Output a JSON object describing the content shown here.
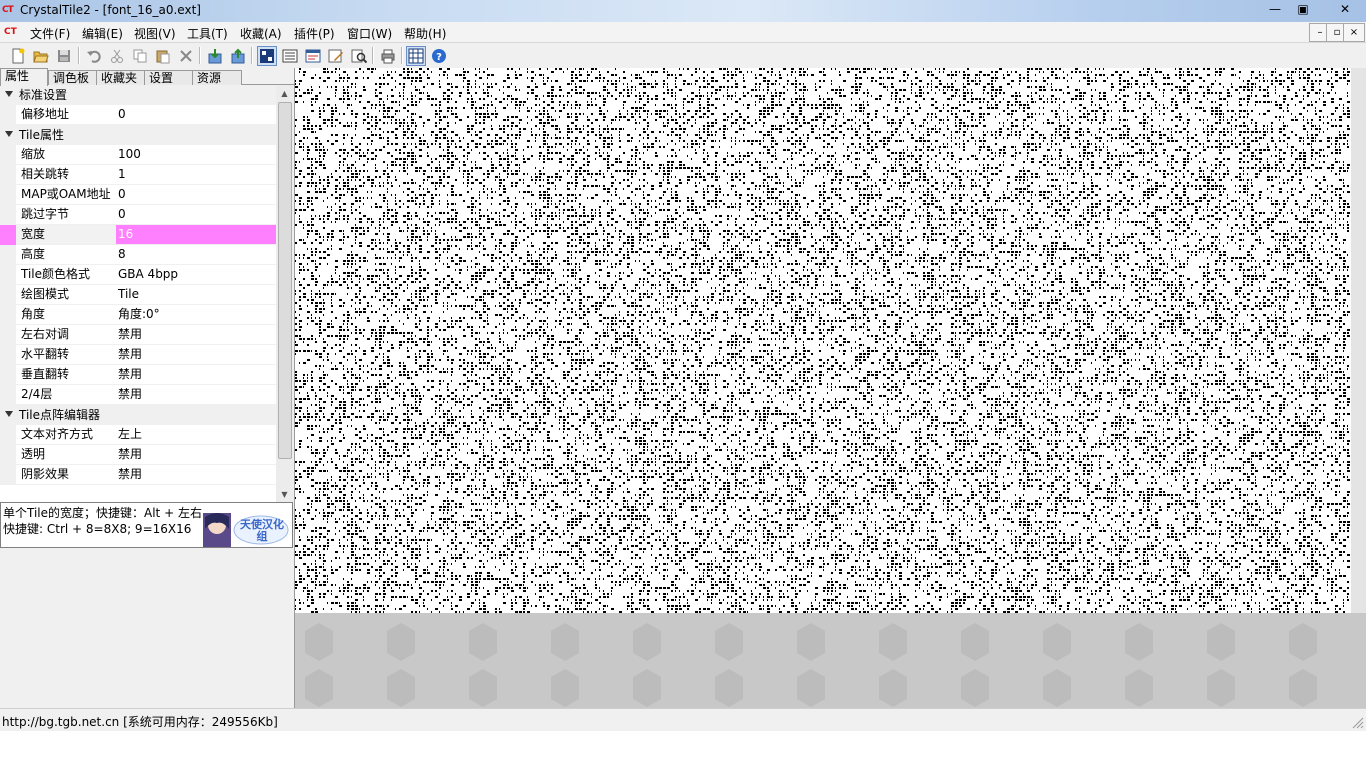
{
  "window": {
    "title": "CrystalTile2 - [font_16_a0.ext]",
    "logo_text": "CT",
    "controls": [
      "—",
      "▣",
      "✕"
    ]
  },
  "menu": {
    "items": [
      "文件(F)",
      "编辑(E)",
      "视图(V)",
      "工具(T)",
      "收藏(A)",
      "插件(P)",
      "窗口(W)",
      "帮助(H)"
    ],
    "mdi_controls": [
      "–",
      "▫",
      "×"
    ]
  },
  "toolbar": {
    "buttons": [
      "new-file",
      "open-folder",
      "save",
      "undo",
      "cut",
      "copy",
      "paste",
      "delete",
      "import",
      "export",
      "tile-view",
      "hex-view",
      "map-view",
      "edit",
      "search",
      "print",
      "grid",
      "help"
    ]
  },
  "left_panel": {
    "tabs": [
      "属性",
      "调色板",
      "收藏夹",
      "设置",
      "资源"
    ],
    "properties": [
      {
        "type": "category",
        "label": "标准设置"
      },
      {
        "type": "prop",
        "name": "偏移地址",
        "value": "0"
      },
      {
        "type": "category",
        "label": "Tile属性"
      },
      {
        "type": "prop",
        "name": "缩放",
        "value": "100"
      },
      {
        "type": "prop",
        "name": "相关跳转",
        "value": "1"
      },
      {
        "type": "prop",
        "name": "MAP或OAM地址",
        "value": "0"
      },
      {
        "type": "prop",
        "name": "跳过字节",
        "value": "0"
      },
      {
        "type": "prop",
        "name": "宽度",
        "value": "16",
        "selected": true
      },
      {
        "type": "prop",
        "name": "高度",
        "value": "8"
      },
      {
        "type": "prop",
        "name": "Tile颜色格式",
        "value": "GBA  4bpp"
      },
      {
        "type": "prop",
        "name": "绘图模式",
        "value": "Tile"
      },
      {
        "type": "prop",
        "name": "角度",
        "value": "角度:0°"
      },
      {
        "type": "prop",
        "name": "左右对调",
        "value": "禁用"
      },
      {
        "type": "prop",
        "name": "水平翻转",
        "value": "禁用"
      },
      {
        "type": "prop",
        "name": "垂直翻转",
        "value": "禁用"
      },
      {
        "type": "prop",
        "name": "2/4层",
        "value": "禁用"
      },
      {
        "type": "category",
        "label": "Tile点阵编辑器"
      },
      {
        "type": "prop",
        "name": "文本对齐方式",
        "value": "左上"
      },
      {
        "type": "prop",
        "name": "透明",
        "value": "禁用"
      },
      {
        "type": "prop",
        "name": "阴影效果",
        "value": "禁用"
      }
    ],
    "help": {
      "line1": "单个Tile的宽度；快捷键：Alt + 左右",
      "line2": "快捷键: Ctrl + 8=8X8; 9=16X16",
      "logo_text": "天使汉化组"
    }
  },
  "status": {
    "text": "http://bg.tgb.net.cn [系统可用内存：249556Kb]"
  },
  "colors": {
    "selection": "#ff80ff",
    "panel_bg": "#f0f0f0",
    "canvas_bg": "#c8c8c8"
  }
}
